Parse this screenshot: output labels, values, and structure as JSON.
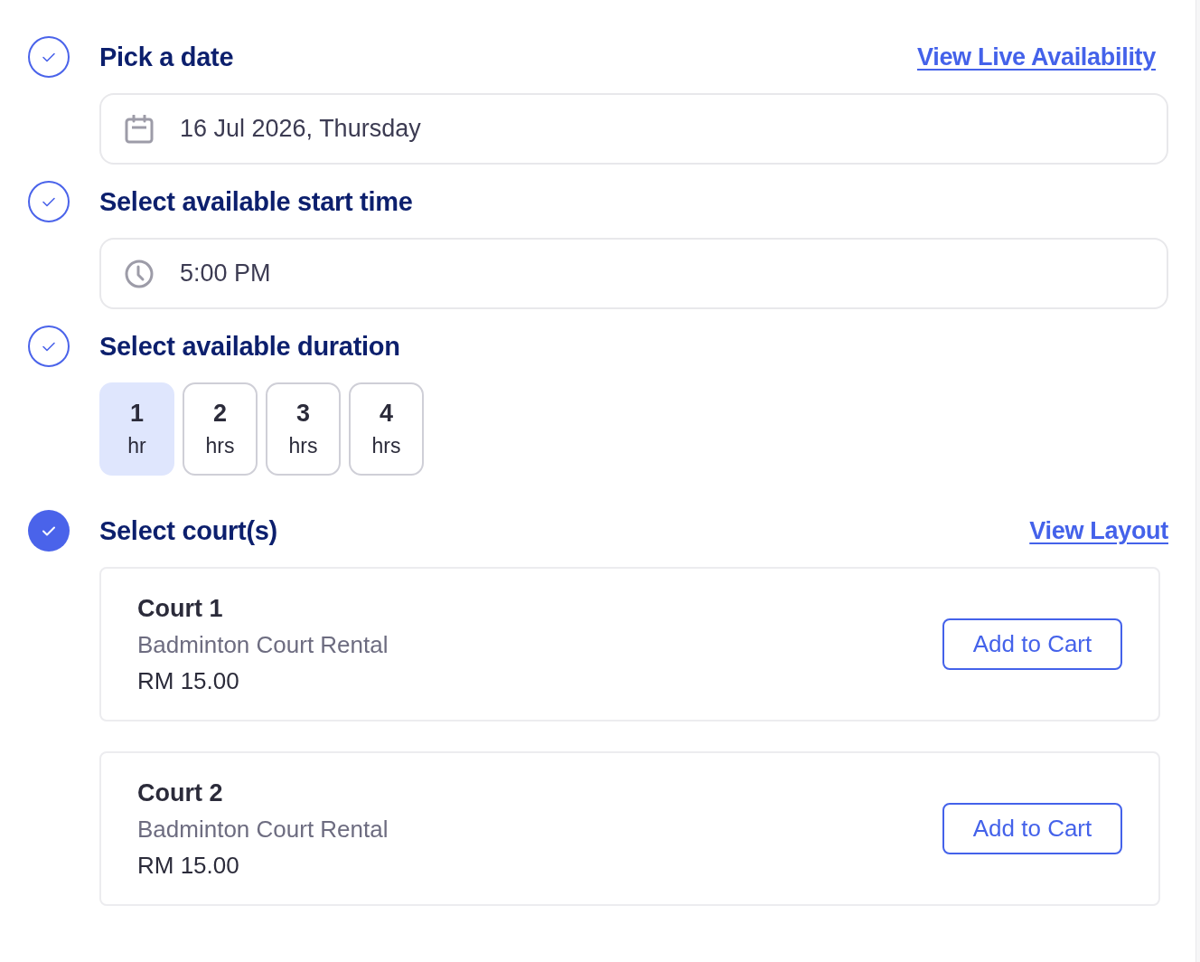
{
  "steps": [
    {
      "kind": "date",
      "title": "Pick a date",
      "current": false,
      "link": "View Live Availability",
      "value": "16 Jul 2026, Thursday"
    },
    {
      "kind": "time",
      "title": "Select available start time",
      "current": false,
      "value": "5:00 PM"
    },
    {
      "kind": "duration",
      "title": "Select available duration",
      "current": false,
      "options": [
        {
          "number": "1",
          "unit": "hr",
          "selected": true
        },
        {
          "number": "2",
          "unit": "hrs",
          "selected": false
        },
        {
          "number": "3",
          "unit": "hrs",
          "selected": false
        },
        {
          "number": "4",
          "unit": "hrs",
          "selected": false
        }
      ]
    },
    {
      "kind": "courts",
      "title": "Select court(s)",
      "current": true,
      "link": "View Layout",
      "courts": [
        {
          "name": "Court 1",
          "description": "Badminton Court Rental",
          "price": "RM 15.00",
          "button": "Add to Cart"
        },
        {
          "name": "Court 2",
          "description": "Badminton Court Rental",
          "price": "RM 15.00",
          "button": "Add to Cart"
        }
      ]
    }
  ]
}
